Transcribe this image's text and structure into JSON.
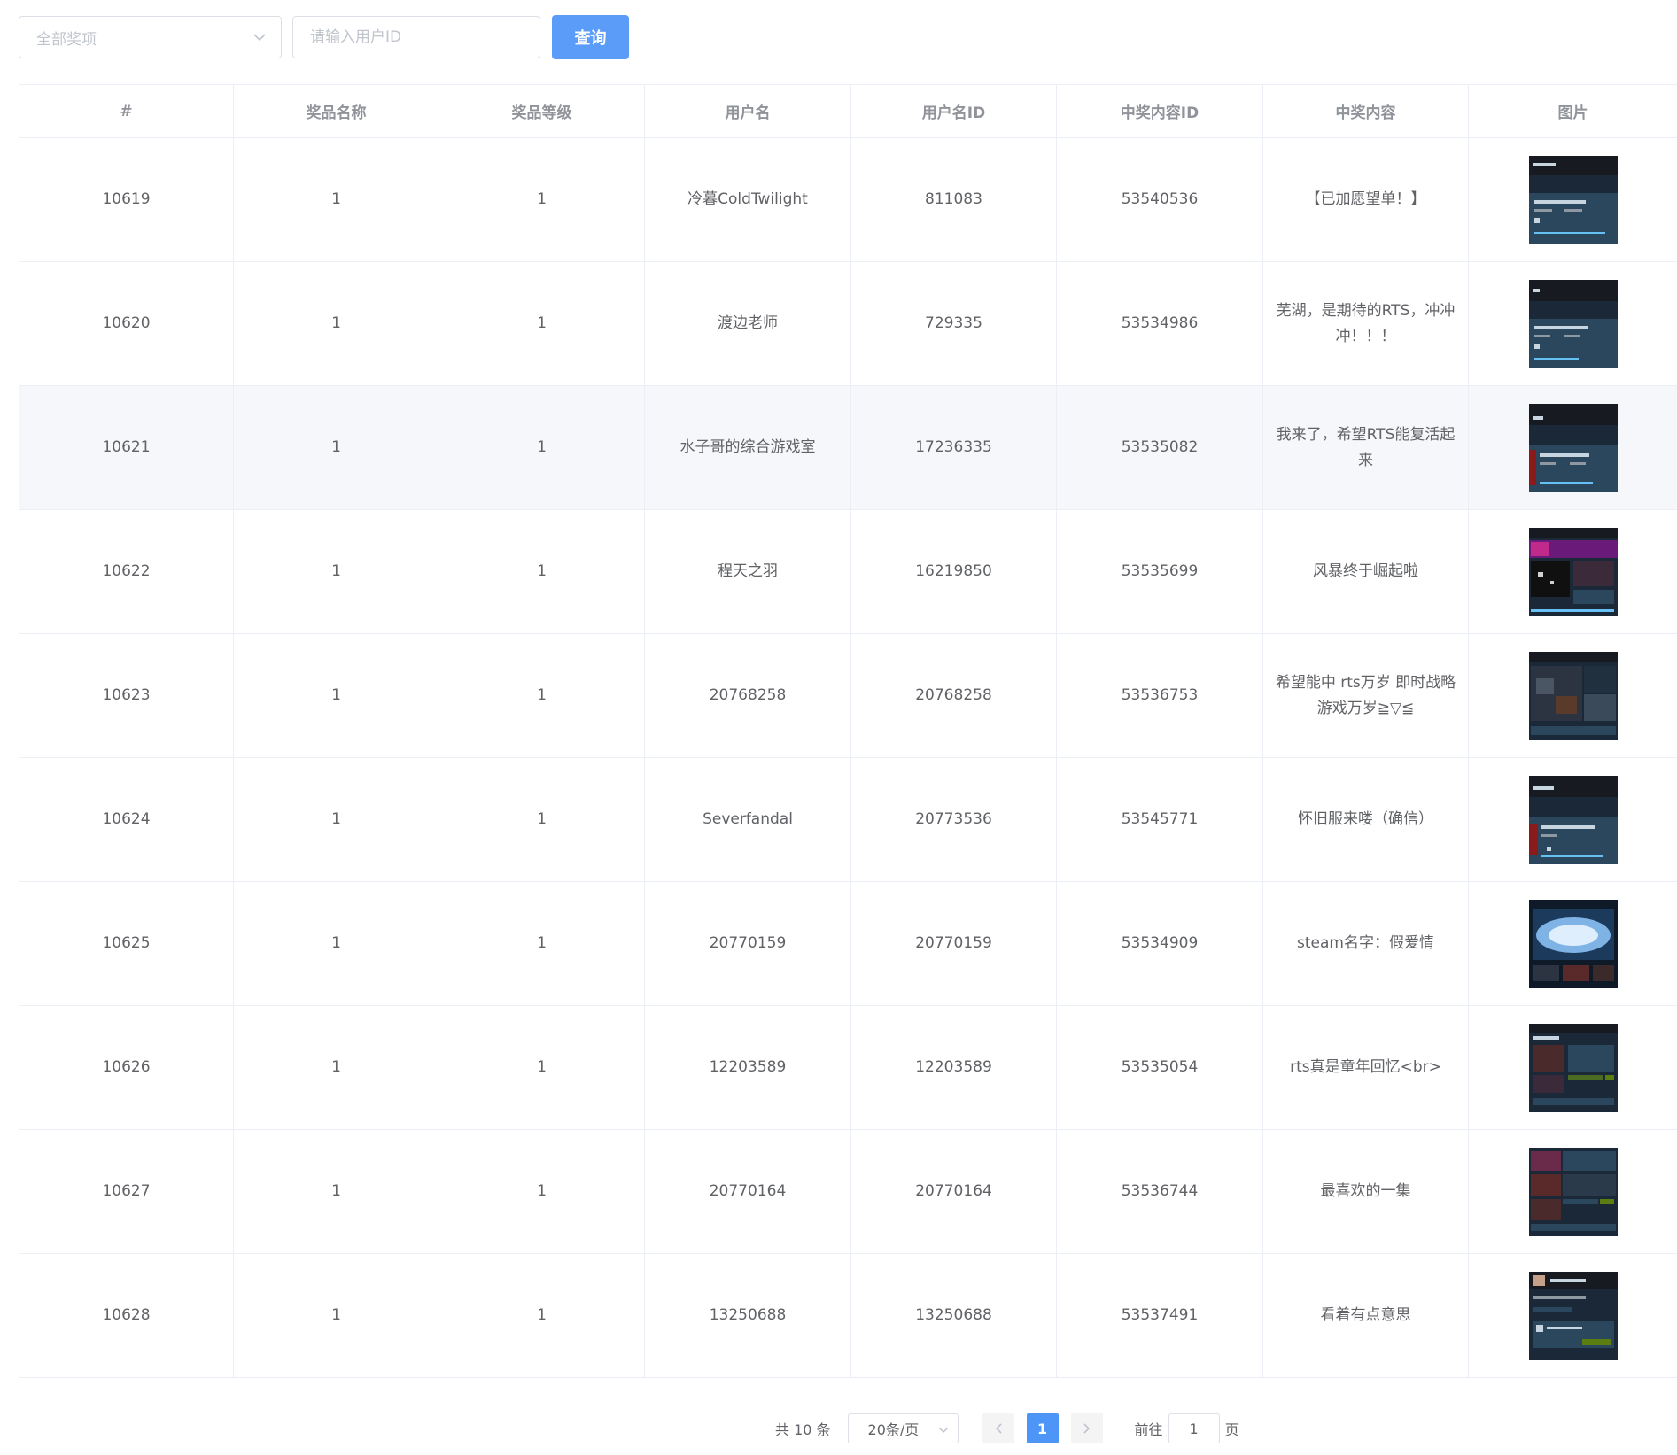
{
  "filter": {
    "prize_select_value": "全部奖项",
    "user_id_placeholder": "请输入用户ID",
    "query_label": "查询"
  },
  "table": {
    "headers": [
      "#",
      "奖品名称",
      "奖品等级",
      "用户名",
      "用户名ID",
      "中奖内容ID",
      "中奖内容",
      "图片"
    ],
    "rows": [
      {
        "id": "10619",
        "prize_name": "1",
        "prize_level": "1",
        "username": "冷暮ColdTwilight",
        "user_id": "811083",
        "content_id": "53540536",
        "content": "【已加愿望单！】",
        "image": "steam-screenshot"
      },
      {
        "id": "10620",
        "prize_name": "1",
        "prize_level": "1",
        "username": "渡边老师",
        "user_id": "729335",
        "content_id": "53534986",
        "content": "芜湖，是期待的RTS，冲冲冲！！！",
        "image": "steam-screenshot"
      },
      {
        "id": "10621",
        "prize_name": "1",
        "prize_level": "1",
        "username": "水子哥的综合游戏室",
        "user_id": "17236335",
        "content_id": "53535082",
        "content": "我来了，希望RTS能复活起来",
        "image": "steam-screenshot"
      },
      {
        "id": "10622",
        "prize_name": "1",
        "prize_level": "1",
        "username": "程天之羽",
        "user_id": "16219850",
        "content_id": "53535699",
        "content": "风暴终于崛起啦",
        "image": "steam-screenshot"
      },
      {
        "id": "10623",
        "prize_name": "1",
        "prize_level": "1",
        "username": "20768258",
        "user_id": "20768258",
        "content_id": "53536753",
        "content": "希望能中 rts万岁 即时战略游戏万岁≧▽≦",
        "image": "steam-screenshot"
      },
      {
        "id": "10624",
        "prize_name": "1",
        "prize_level": "1",
        "username": "Severfandal",
        "user_id": "20773536",
        "content_id": "53545771",
        "content": "怀旧服来喽（确信）",
        "image": "steam-screenshot"
      },
      {
        "id": "10625",
        "prize_name": "1",
        "prize_level": "1",
        "username": "20770159",
        "user_id": "20770159",
        "content_id": "53534909",
        "content": "steam名字：假爱情",
        "image": "steam-screenshot"
      },
      {
        "id": "10626",
        "prize_name": "1",
        "prize_level": "1",
        "username": "12203589",
        "user_id": "12203589",
        "content_id": "53535054",
        "content": "rts真是童年回忆<br>",
        "image": "steam-screenshot"
      },
      {
        "id": "10627",
        "prize_name": "1",
        "prize_level": "1",
        "username": "20770164",
        "user_id": "20770164",
        "content_id": "53536744",
        "content": "最喜欢的一集",
        "image": "steam-screenshot"
      },
      {
        "id": "10628",
        "prize_name": "1",
        "prize_level": "1",
        "username": "13250688",
        "user_id": "13250688",
        "content_id": "53537491",
        "content": "看着有点意思",
        "image": "steam-screenshot"
      }
    ]
  },
  "pagination": {
    "total": "共 10 条",
    "page_size": "20条/页",
    "current_page": "1",
    "goto_label": "前往",
    "goto_value": "1",
    "page_suffix": "页"
  },
  "colors": {
    "primary": "#409eff",
    "button": "#5a9cf8",
    "border": "#ebeef5",
    "header_text": "#909399",
    "text": "#606266",
    "hover_row": "#f5f7fa"
  },
  "icons": {
    "select_caret": "chevron-down-icon",
    "prev": "chevron-left-icon",
    "next": "chevron-right-icon",
    "page_size_caret": "chevron-down-icon"
  }
}
